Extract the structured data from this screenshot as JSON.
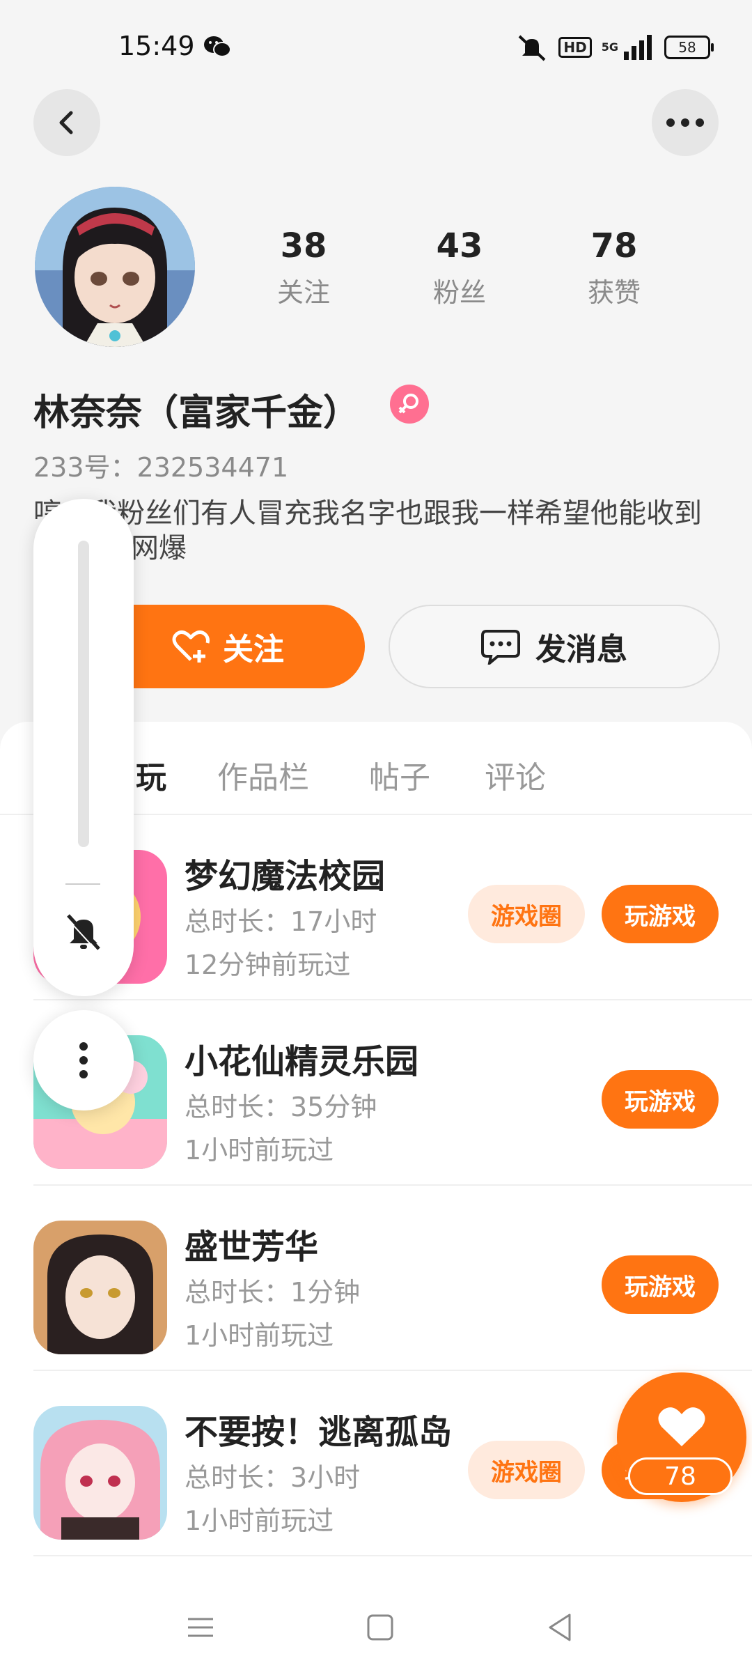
{
  "status_bar": {
    "time": "15:49",
    "hd": "HD",
    "signal": "5G",
    "battery": "58"
  },
  "profile": {
    "stats": [
      {
        "value": "38",
        "label": "关注"
      },
      {
        "value": "43",
        "label": "粉丝"
      },
      {
        "value": "78",
        "label": "获赞"
      }
    ],
    "name": "林奈奈（富家千金）",
    "uid": "233号：232534471",
    "bio_line1": "哼，我粉丝们有人冒充我名字也跟我一样希望他能收到",
    "bio_line2": "网爆"
  },
  "actions": {
    "follow": "关注",
    "message": "发消息"
  },
  "tabs": [
    "玩",
    "作品栏",
    "帖子",
    "评论"
  ],
  "games": [
    {
      "title": "梦幻魔法校园",
      "duration": "总时长：17小时",
      "last_played": "12分钟前玩过",
      "circle_label": "游戏圈",
      "play_label": "玩游戏"
    },
    {
      "title": "小花仙精灵乐园",
      "duration": "总时长：35分钟",
      "last_played": "1小时前玩过",
      "circle_label": "",
      "play_label": "玩游戏"
    },
    {
      "title": "盛世芳华",
      "duration": "总时长：1分钟",
      "last_played": "1小时前玩过",
      "circle_label": "",
      "play_label": "玩游戏"
    },
    {
      "title": "不要按！逃离孤岛",
      "duration": "总时长：3小时",
      "last_played": "1小时前玩过",
      "circle_label": "游戏圈",
      "play_label": "玩游戏"
    }
  ],
  "like_fab": {
    "count": "78"
  },
  "colors": {
    "accent": "#ff7412",
    "accent_light": "#ffeadd",
    "gender": "#ff6f91"
  }
}
